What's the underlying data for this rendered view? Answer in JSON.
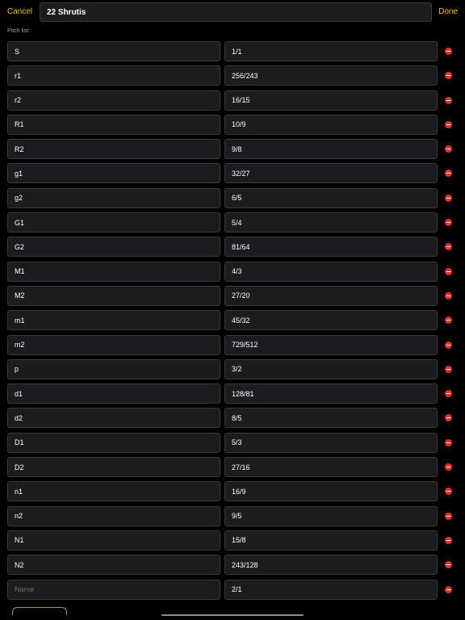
{
  "header": {
    "cancel_label": "Cancel",
    "done_label": "Done",
    "title_value": "22 Shrutis"
  },
  "section_label": "Pitch list:",
  "colors": {
    "accent": "#f0c419",
    "remove": "#e5322b",
    "field_background": "#1c1c1e"
  },
  "pitches": [
    {
      "name": "S",
      "ratio": "1/1"
    },
    {
      "name": "r1",
      "ratio": "256/243"
    },
    {
      "name": "r2",
      "ratio": "16/15"
    },
    {
      "name": "R1",
      "ratio": "10/9"
    },
    {
      "name": "R2",
      "ratio": "9/8"
    },
    {
      "name": "g1",
      "ratio": "32/27"
    },
    {
      "name": "g2",
      "ratio": "6/5"
    },
    {
      "name": "G1",
      "ratio": "5/4"
    },
    {
      "name": "G2",
      "ratio": "81/64"
    },
    {
      "name": "M1",
      "ratio": "4/3"
    },
    {
      "name": "M2",
      "ratio": "27/20"
    },
    {
      "name": "m1",
      "ratio": "45/32"
    },
    {
      "name": "m2",
      "ratio": "729/512"
    },
    {
      "name": "p",
      "ratio": "3/2"
    },
    {
      "name": "d1",
      "ratio": "128/81"
    },
    {
      "name": "d2",
      "ratio": "8/5"
    },
    {
      "name": "D1",
      "ratio": "5/3"
    },
    {
      "name": "D2",
      "ratio": "27/16"
    },
    {
      "name": "n1",
      "ratio": "16/9"
    },
    {
      "name": "n2",
      "ratio": "9/5"
    },
    {
      "name": "N1",
      "ratio": "15/8"
    },
    {
      "name": "N2",
      "ratio": "243/128"
    },
    {
      "name": "",
      "name_placeholder": "Name",
      "ratio": "2/1"
    }
  ]
}
